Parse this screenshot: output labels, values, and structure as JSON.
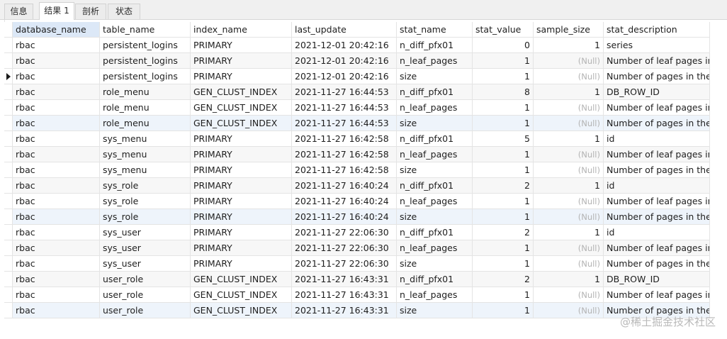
{
  "tabs": [
    {
      "label": "信息",
      "active": false
    },
    {
      "label": "结果 1",
      "active": true
    },
    {
      "label": "剖析",
      "active": false
    },
    {
      "label": "状态",
      "active": false
    }
  ],
  "columns": [
    "database_name",
    "table_name",
    "index_name",
    "last_update",
    "stat_name",
    "stat_value",
    "sample_size",
    "stat_description"
  ],
  "null_text": "(Null)",
  "current_row_index": 2,
  "rows": [
    [
      "rbac",
      "persistent_logins",
      "PRIMARY",
      "2021-12-01 20:42:16",
      "n_diff_pfx01",
      "0",
      "1",
      "series"
    ],
    [
      "rbac",
      "persistent_logins",
      "PRIMARY",
      "2021-12-01 20:42:16",
      "n_leaf_pages",
      "1",
      "(Null)",
      "Number of leaf pages in t"
    ],
    [
      "rbac",
      "persistent_logins",
      "PRIMARY",
      "2021-12-01 20:42:16",
      "size",
      "1",
      "(Null)",
      "Number of pages in the i"
    ],
    [
      "rbac",
      "role_menu",
      "GEN_CLUST_INDEX",
      "2021-11-27 16:44:53",
      "n_diff_pfx01",
      "8",
      "1",
      "DB_ROW_ID"
    ],
    [
      "rbac",
      "role_menu",
      "GEN_CLUST_INDEX",
      "2021-11-27 16:44:53",
      "n_leaf_pages",
      "1",
      "(Null)",
      "Number of leaf pages in t"
    ],
    [
      "rbac",
      "role_menu",
      "GEN_CLUST_INDEX",
      "2021-11-27 16:44:53",
      "size",
      "1",
      "(Null)",
      "Number of pages in the i"
    ],
    [
      "rbac",
      "sys_menu",
      "PRIMARY",
      "2021-11-27 16:42:58",
      "n_diff_pfx01",
      "5",
      "1",
      "id"
    ],
    [
      "rbac",
      "sys_menu",
      "PRIMARY",
      "2021-11-27 16:42:58",
      "n_leaf_pages",
      "1",
      "(Null)",
      "Number of leaf pages in t"
    ],
    [
      "rbac",
      "sys_menu",
      "PRIMARY",
      "2021-11-27 16:42:58",
      "size",
      "1",
      "(Null)",
      "Number of pages in the i"
    ],
    [
      "rbac",
      "sys_role",
      "PRIMARY",
      "2021-11-27 16:40:24",
      "n_diff_pfx01",
      "2",
      "1",
      "id"
    ],
    [
      "rbac",
      "sys_role",
      "PRIMARY",
      "2021-11-27 16:40:24",
      "n_leaf_pages",
      "1",
      "(Null)",
      "Number of leaf pages in t"
    ],
    [
      "rbac",
      "sys_role",
      "PRIMARY",
      "2021-11-27 16:40:24",
      "size",
      "1",
      "(Null)",
      "Number of pages in the i"
    ],
    [
      "rbac",
      "sys_user",
      "PRIMARY",
      "2021-11-27 22:06:30",
      "n_diff_pfx01",
      "2",
      "1",
      "id"
    ],
    [
      "rbac",
      "sys_user",
      "PRIMARY",
      "2021-11-27 22:06:30",
      "n_leaf_pages",
      "1",
      "(Null)",
      "Number of leaf pages in t"
    ],
    [
      "rbac",
      "sys_user",
      "PRIMARY",
      "2021-11-27 22:06:30",
      "size",
      "1",
      "(Null)",
      "Number of pages in the i"
    ],
    [
      "rbac",
      "user_role",
      "GEN_CLUST_INDEX",
      "2021-11-27 16:43:31",
      "n_diff_pfx01",
      "2",
      "1",
      "DB_ROW_ID"
    ],
    [
      "rbac",
      "user_role",
      "GEN_CLUST_INDEX",
      "2021-11-27 16:43:31",
      "n_leaf_pages",
      "1",
      "(Null)",
      "Number of leaf pages in t"
    ],
    [
      "rbac",
      "user_role",
      "GEN_CLUST_INDEX",
      "2021-11-27 16:43:31",
      "size",
      "1",
      "(Null)",
      "Number of pages in the i"
    ]
  ],
  "watermark": "@稀土掘金技术社区"
}
